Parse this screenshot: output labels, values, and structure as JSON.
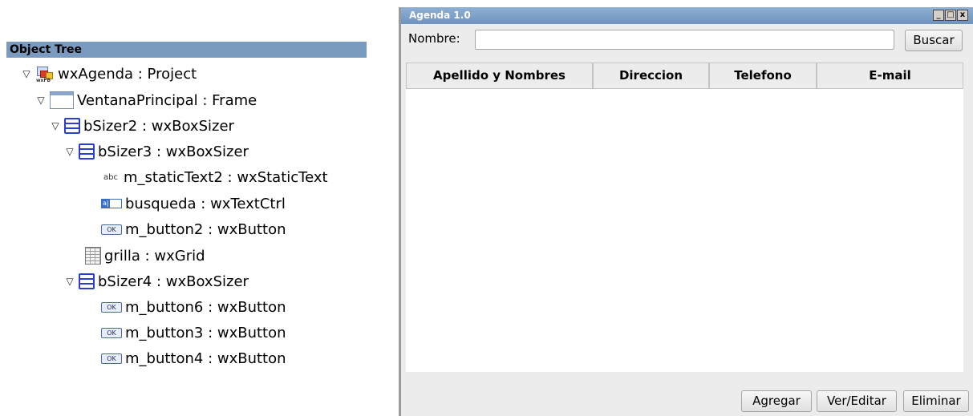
{
  "tree": {
    "header": "Object Tree",
    "nodes": [
      {
        "label": "wxAgenda : Project",
        "icon": "project-icon",
        "expanded": true
      },
      {
        "label": "VentanaPrincipal : Frame",
        "icon": "frame-icon",
        "expanded": true
      },
      {
        "label": "bSizer2 : wxBoxSizer",
        "icon": "sizer-icon",
        "expanded": true
      },
      {
        "label": "bSizer3 : wxBoxSizer",
        "icon": "sizer-icon",
        "expanded": true
      },
      {
        "label": "m_staticText2 : wxStaticText",
        "icon": "static-text-icon"
      },
      {
        "label": "busqueda : wxTextCtrl",
        "icon": "text-ctrl-icon"
      },
      {
        "label": "m_button2 : wxButton",
        "icon": "button-icon"
      },
      {
        "label": "grilla : wxGrid",
        "icon": "grid-icon"
      },
      {
        "label": "bSizer4 : wxBoxSizer",
        "icon": "sizer-icon",
        "expanded": true
      },
      {
        "label": "m_button6 : wxButton",
        "icon": "button-icon"
      },
      {
        "label": "m_button3 : wxButton",
        "icon": "button-icon"
      },
      {
        "label": "m_button4 : wxButton",
        "icon": "button-icon"
      }
    ]
  },
  "window": {
    "title": "Agenda 1.0",
    "controls": {
      "minimize": "_",
      "maximize": "□",
      "close": "x"
    },
    "search": {
      "label": "Nombre:",
      "value": "",
      "button": "Buscar"
    },
    "grid": {
      "columns": [
        "Apellido y Nombres",
        "Direccion",
        "Telefono",
        "E-mail"
      ],
      "rows": []
    },
    "buttons": {
      "add": "Agregar",
      "edit": "Ver/Editar",
      "delete": "Eliminar"
    }
  },
  "colors": {
    "tree_header_bg": "#7a9bbf",
    "titlebar": "#7c9ec6",
    "window_bg": "#ececec"
  }
}
